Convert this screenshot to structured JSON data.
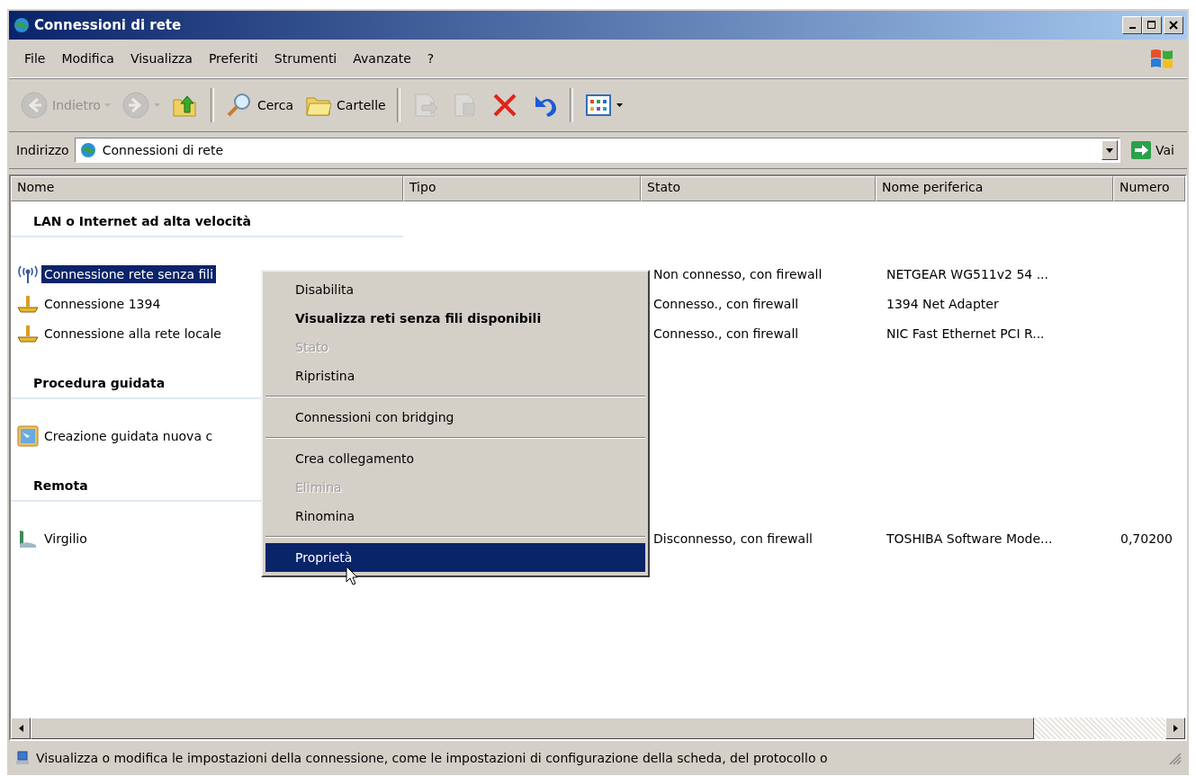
{
  "window": {
    "title": "Connessioni di rete"
  },
  "menu": [
    "File",
    "Modifica",
    "Visualizza",
    "Preferiti",
    "Strumenti",
    "Avanzate",
    "?"
  ],
  "toolbar": [
    {
      "kind": "back",
      "label": "Indietro",
      "disabled": true,
      "dropdown": true
    },
    {
      "kind": "forward",
      "disabled": true,
      "dropdown": true
    },
    {
      "kind": "up",
      "disabled": false
    },
    {
      "kind": "separator"
    },
    {
      "kind": "search",
      "label": "Cerca",
      "disabled": false
    },
    {
      "kind": "folders",
      "label": "Cartelle",
      "disabled": false
    },
    {
      "kind": "separator"
    },
    {
      "kind": "move",
      "disabled": true
    },
    {
      "kind": "copy",
      "disabled": true
    },
    {
      "kind": "delete",
      "disabled": false
    },
    {
      "kind": "undo",
      "disabled": false
    },
    {
      "kind": "separator"
    },
    {
      "kind": "views",
      "disabled": false,
      "dropdown": true
    }
  ],
  "address": {
    "label": "Indirizzo",
    "value": "Connessioni di rete",
    "go": "Vai"
  },
  "columns": [
    "Nome",
    "Tipo",
    "Stato",
    "Nome periferica",
    "Numero"
  ],
  "groups": [
    {
      "title": "LAN o Internet ad alta velocità",
      "items": [
        {
          "kind": "wireless",
          "name": "Connessione rete senza fili",
          "selected": true,
          "stato": "Non connesso, con firewall",
          "periferica": "NETGEAR WG511v2 54 ..."
        },
        {
          "kind": "lan",
          "name": "Connessione 1394",
          "selected": false,
          "stato": "Connesso., con firewall",
          "periferica": "1394 Net Adapter"
        },
        {
          "kind": "lan",
          "name": "Connessione alla rete locale",
          "selected": false,
          "stato": "Connesso., con firewall",
          "periferica": "NIC Fast Ethernet PCI R..."
        }
      ]
    },
    {
      "title": "Procedura guidata",
      "items": [
        {
          "kind": "wizard",
          "name": "Creazione guidata nuova c",
          "selected": false
        }
      ]
    },
    {
      "title": "Remota",
      "items": [
        {
          "kind": "dialup",
          "name": "Virgilio",
          "selected": false,
          "stato": "Disconnesso, con firewall",
          "periferica": "TOSHIBA Software Mode...",
          "numero": "0,70200"
        }
      ]
    }
  ],
  "context_menu": [
    {
      "kind": "item",
      "label": "Disabilita",
      "bold": false,
      "disabled": false,
      "selected": false
    },
    {
      "kind": "item",
      "label": "Visualizza reti senza fili disponibili",
      "bold": true,
      "disabled": false,
      "selected": false
    },
    {
      "kind": "item",
      "label": "Stato",
      "bold": false,
      "disabled": true,
      "selected": false
    },
    {
      "kind": "item",
      "label": "Ripristina",
      "bold": false,
      "disabled": false,
      "selected": false
    },
    {
      "kind": "separator"
    },
    {
      "kind": "item",
      "label": "Connessioni con bridging",
      "bold": false,
      "disabled": false,
      "selected": false
    },
    {
      "kind": "separator"
    },
    {
      "kind": "item",
      "label": "Crea collegamento",
      "bold": false,
      "disabled": false,
      "selected": false
    },
    {
      "kind": "item",
      "label": "Elimina",
      "bold": false,
      "disabled": true,
      "selected": false
    },
    {
      "kind": "item",
      "label": "Rinomina",
      "bold": false,
      "disabled": false,
      "selected": false
    },
    {
      "kind": "separator"
    },
    {
      "kind": "item",
      "label": "Proprietà",
      "bold": false,
      "disabled": false,
      "selected": true
    }
  ],
  "status_bar": "Visualizza o modifica le impostazioni della connessione, come le impostazioni di configurazione della scheda, del protocollo o"
}
